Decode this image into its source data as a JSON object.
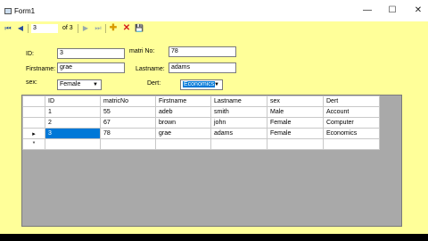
{
  "window": {
    "title": "Form1",
    "min_glyph": "—",
    "max_glyph": "☐",
    "close_glyph": "✕"
  },
  "navigator": {
    "position": "3",
    "count_text": "of 3",
    "icons": {
      "first": "⏮",
      "prev": "◀",
      "next": "▶",
      "last": "⏭",
      "add": "✚",
      "delete": "✕",
      "save": "💾"
    }
  },
  "form": {
    "id_label": "ID:",
    "id_value": "3",
    "matric_label": "matri No:",
    "matric_value": "78",
    "firstname_label": "Firstname:",
    "firstname_value": "grae",
    "lastname_label": "Lastname:",
    "lastname_value": "adams",
    "sex_label": "sex:",
    "sex_value": "Female",
    "dept_label": "Dert:",
    "dept_value": "Economics"
  },
  "grid": {
    "columns": [
      "ID",
      "matricNo",
      "Firstname",
      "Lastname",
      "sex",
      "Dert"
    ],
    "rows": [
      {
        "marker": "",
        "cells": [
          "1",
          "55",
          "adeb",
          "smith",
          "Male",
          "Account"
        ]
      },
      {
        "marker": "",
        "cells": [
          "2",
          "67",
          "brown",
          "john",
          "Female",
          "Computer"
        ]
      },
      {
        "marker": "▸",
        "cells": [
          "3",
          "78",
          "grae",
          "adams",
          "Female",
          "Economics"
        ]
      }
    ],
    "new_row_marker": "*"
  },
  "colors": {
    "form_bg": "#ffff99",
    "grid_bg": "#a9a9a9",
    "selection": "#0078d7"
  }
}
